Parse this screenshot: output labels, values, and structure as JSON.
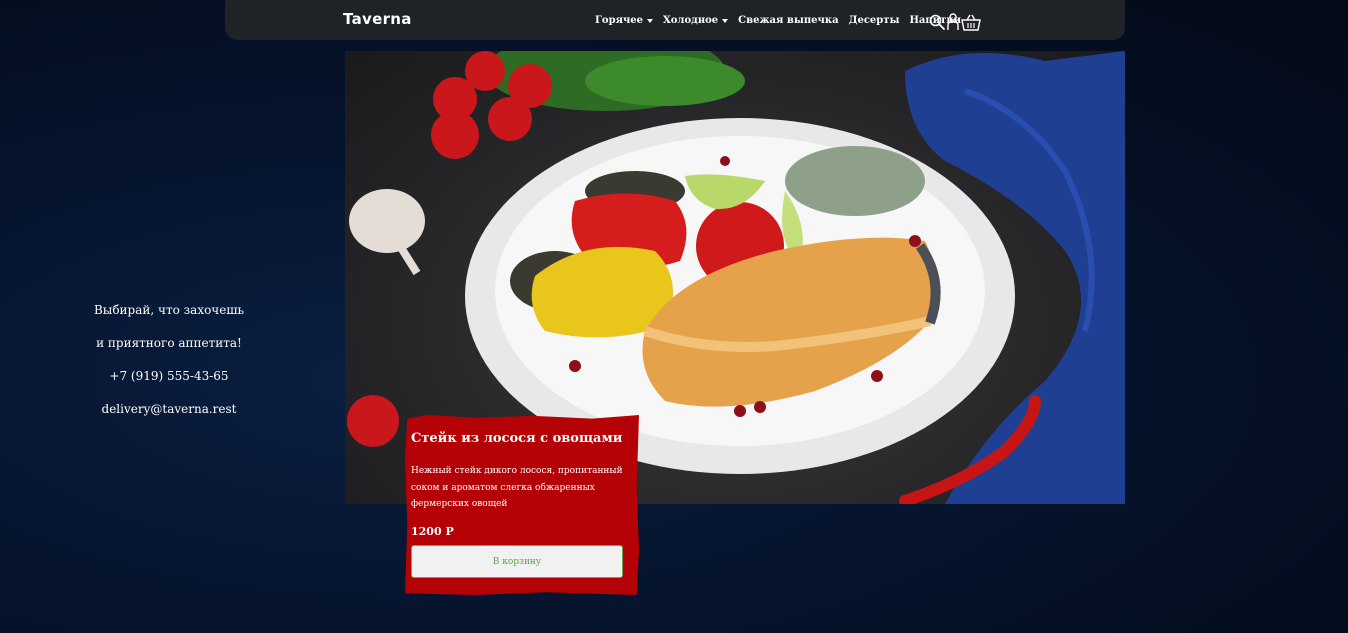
{
  "navbar": {
    "brand": "Taverna",
    "links": [
      {
        "label": "Горячее",
        "dropdown": true
      },
      {
        "label": "Холодное",
        "dropdown": true
      },
      {
        "label": "Свежая выпечка",
        "dropdown": false
      },
      {
        "label": "Десерты",
        "dropdown": false
      },
      {
        "label": "Напитки",
        "dropdown": false
      }
    ],
    "icons": [
      "search-icon",
      "user-icon",
      "basket-icon"
    ]
  },
  "info": {
    "line1": "Выбирай, что захочешь",
    "line2": "и приятного аппетита!",
    "phone": "+7 (919) 555-43-65",
    "email": "delivery@taverna.rest"
  },
  "product": {
    "title": "Стейк из лосося с овощами",
    "description": "Нежный стейк дикого лосося, пропитанный соком и ароматом слегка обжаренных фермерских овощей",
    "price": "1200 Р",
    "button_label": "В корзину"
  },
  "colors": {
    "background": "#06142d",
    "navbar": "#1f2227",
    "card": "#b50207",
    "button_text": "#58a543"
  }
}
